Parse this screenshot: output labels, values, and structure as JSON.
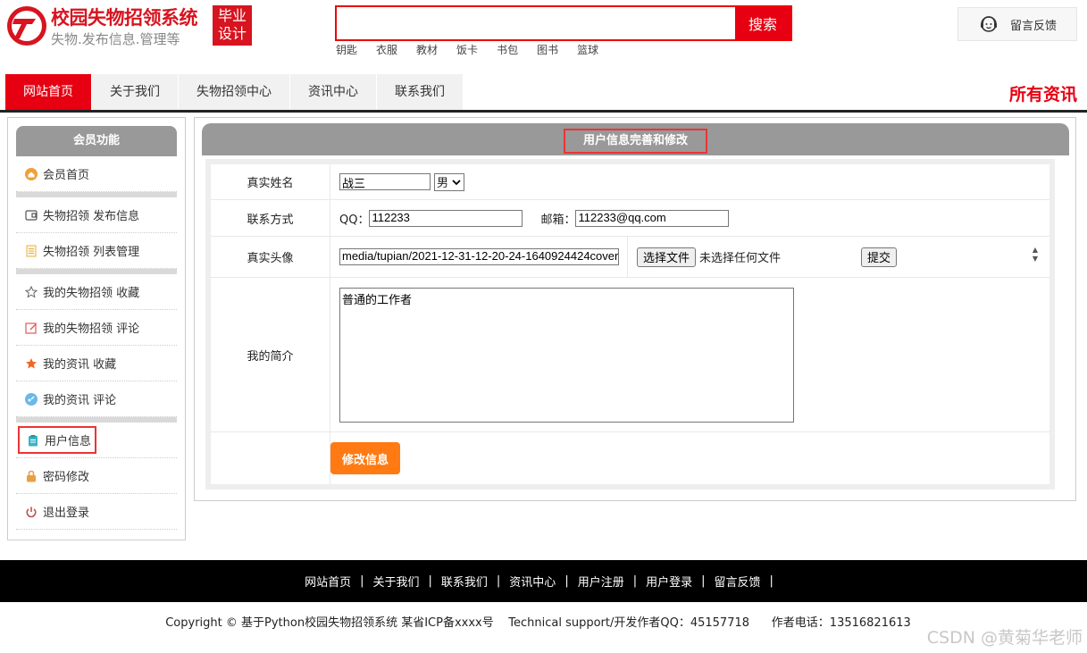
{
  "site": {
    "title": "校园失物招领系统",
    "subtitle": "失物.发布信息.管理等",
    "badge_line1": "毕业",
    "badge_line2": "设计"
  },
  "search": {
    "placeholder": "",
    "button_label": "搜索",
    "hot_tags": [
      "钥匙",
      "衣服",
      "教材",
      "饭卡",
      "书包",
      "图书",
      "篮球"
    ]
  },
  "feedback_label": "留言反馈",
  "nav": {
    "items": [
      "网站首页",
      "关于我们",
      "失物招领中心",
      "资讯中心",
      "联系我们"
    ],
    "active_index": 0,
    "right_label": "所有资讯"
  },
  "sidebar": {
    "heading": "会员功能",
    "items": [
      {
        "label": "会员首页",
        "icon": "home-circle-icon"
      },
      {
        "label": "失物招领 发布信息",
        "icon": "publish-icon"
      },
      {
        "label": "失物招领 列表管理",
        "icon": "list-doc-icon"
      },
      {
        "label": "我的失物招领 收藏",
        "icon": "star-outline-icon"
      },
      {
        "label": "我的失物招领 评论",
        "icon": "edit-icon"
      },
      {
        "label": "我的资讯 收藏",
        "icon": "star-filled-icon"
      },
      {
        "label": "我的资讯 评论",
        "icon": "comment-circle-icon"
      },
      {
        "label": "用户信息",
        "icon": "clipboard-icon"
      },
      {
        "label": "密码修改",
        "icon": "lock-icon"
      },
      {
        "label": "退出登录",
        "icon": "power-icon"
      }
    ]
  },
  "form": {
    "heading": "用户信息完善和修改",
    "name_label": "真实姓名",
    "name_value": "战三",
    "gender_value": "男",
    "contact_label": "联系方式",
    "qq_label": "QQ：",
    "qq_value": "112233",
    "email_label": "邮箱：",
    "email_value": "112233@qq.com",
    "avatar_label": "真实头像",
    "avatar_path": "media/tupian/2021-12-31-12-20-24-1640924424cover",
    "choose_file_label": "选择文件",
    "no_file_label": "未选择任何文件",
    "upload_label": "提交",
    "bio_label": "我的简介",
    "bio_value": "普通的工作者",
    "submit_label": "修改信息"
  },
  "footer": {
    "links": [
      "网站首页",
      "关于我们",
      "联系我们",
      "资讯中心",
      "用户注册",
      "用户登录",
      "留言反馈"
    ],
    "separator": "|",
    "copyright": "Copyright © 基于Python校园失物招领系统 某省ICP备xxxx号    Technical support/开发作者QQ：45157718      作者电话：13516821613"
  },
  "watermark": "CSDN @黄菊华老师",
  "colors": {
    "brand_red": "#e60012",
    "accent_orange": "#ff7a12",
    "panel_gray": "#999999"
  }
}
